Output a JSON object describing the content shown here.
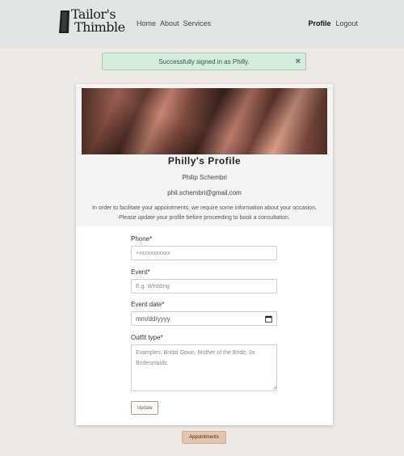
{
  "nav": {
    "brand_line1": "Tailor's",
    "brand_line2": "Thimble",
    "links_left": [
      "Home",
      "About",
      "Services"
    ],
    "links_right": [
      "Profile",
      "Logout"
    ]
  },
  "alert": {
    "message": "Successfully signed in as Philly.",
    "close": "×"
  },
  "profile": {
    "title": "Philly's Profile",
    "name": "Philip Schembri",
    "email": "phil.schembri@gmail.com",
    "info": "In order to facilitate your appointments, we require some information about your occasion. Please update your profile before proceeding to book a consultation."
  },
  "form": {
    "phone_label": "Phone*",
    "phone_placeholder": "+xxxxxxxxxxx",
    "event_label": "Event*",
    "event_placeholder": "E.g. Wedding",
    "date_label": "Event date*",
    "date_placeholder": "mm/dd/yyyy",
    "outfit_label": "Outfit type*",
    "outfit_placeholder": "Examples: Bridal Gown, Mother of the Bride, 3x Bridesmaids",
    "update_label": "Update"
  },
  "footer": {
    "appointments_label": "Appointments"
  },
  "colors": {
    "nav_bg": "#e1e5e6",
    "page_bg": "#efe9e6",
    "alert_bg": "#d5ecdc",
    "accent": "#c58f76",
    "appointments_bg": "#e7c4ad"
  },
  "icons": [
    "thimble-logo-icon",
    "close-icon",
    "calendar-icon",
    "resize-handle-icon"
  ]
}
